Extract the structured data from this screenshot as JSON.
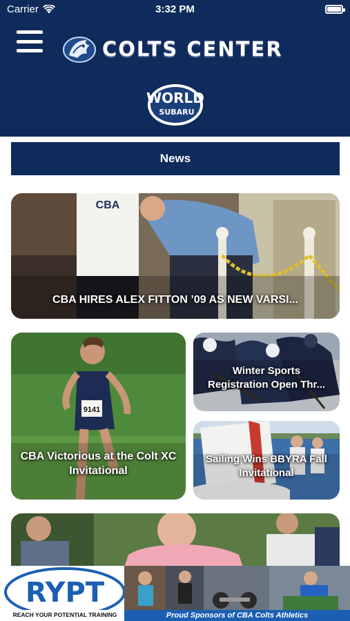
{
  "status_bar": {
    "carrier": "Carrier",
    "time": "3:32 PM",
    "wifi_icon": "wifi-icon",
    "battery_icon": "battery-icon"
  },
  "header": {
    "menu_icon": "hamburger-menu-icon",
    "logo_icon": "colt-head-logo-icon",
    "title": "COLTS CENTER",
    "sponsor": {
      "line1": "WORLD",
      "line2": "SUBARU"
    }
  },
  "section": {
    "label": "News"
  },
  "news": [
    {
      "caption": "CBA HIRES ALEX FITTON ’09 AS NEW VARSI..."
    },
    {
      "caption": "CBA Victorious at the Colt XC Invitational",
      "bib": "9141"
    },
    {
      "caption_line1": "Winter Sports",
      "caption_line2": "Registration Open Thr..."
    },
    {
      "caption": "Sailing Wins BBYRA Fall Invitational"
    },
    {
      "caption": ""
    }
  ],
  "ad_banner": {
    "logo_text": "RYPT",
    "logo_subtext": "REACH YOUR POTENTIAL TRAINING",
    "tagline": "Proud Sponsors of CBA Colts Athletics"
  },
  "colors": {
    "navy": "#0f2b5c",
    "ad_blue": "#1b5fb3"
  }
}
